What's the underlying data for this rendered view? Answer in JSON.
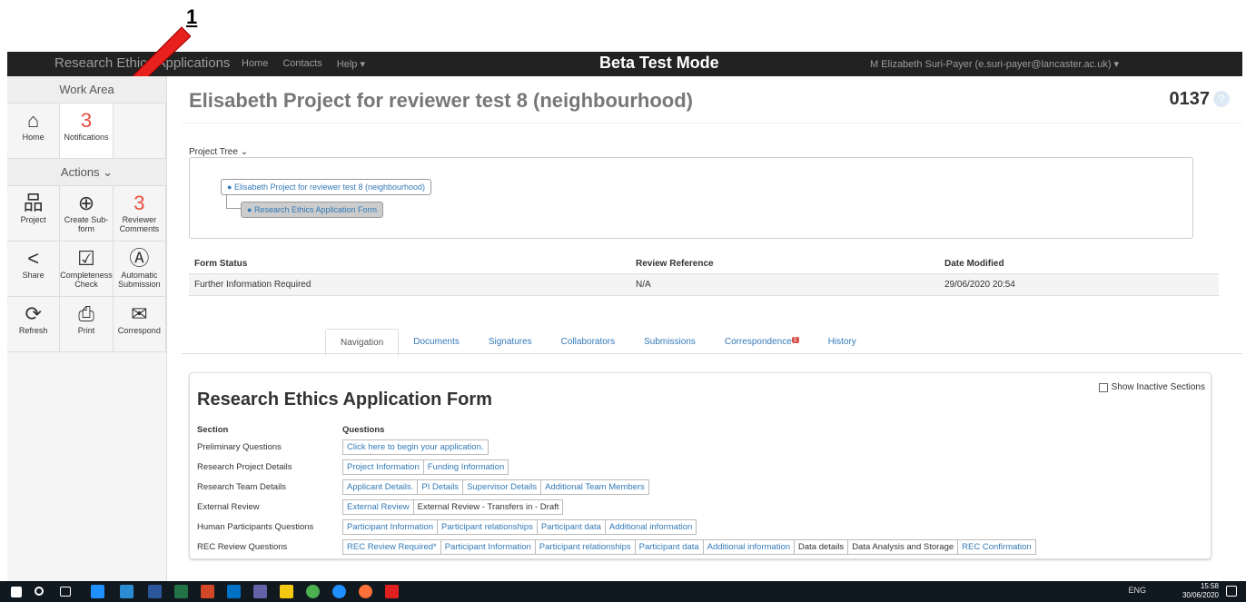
{
  "callout": "1",
  "topbar": {
    "brand": "Research Ethics Applications",
    "nav": [
      "Home",
      "Contacts",
      "Help ▾"
    ],
    "mode": "Beta Test Mode",
    "user": "M Elizabeth Suri-Payer (e.suri-payer@lancaster.ac.uk) ▾"
  },
  "sidebar": {
    "work_area": "Work Area",
    "home": "Home",
    "notifications": "Notifications",
    "notifications_count": "3",
    "actions": "Actions ⌄",
    "project": "Project",
    "create_subform": "Create Sub-form",
    "reviewer_comments": "Reviewer Comments",
    "reviewer_count": "3",
    "share": "Share",
    "completeness": "Completeness Check",
    "auto_submission": "Automatic Submission",
    "refresh": "Refresh",
    "print": "Print",
    "correspond": "Correspond"
  },
  "page": {
    "title": "Elisabeth Project for reviewer test 8 (neighbourhood)",
    "number": "0137",
    "help": "?"
  },
  "tree": {
    "label": "Project Tree ⌄",
    "root": "Elisabeth Project for reviewer test 8 (neighbourhood)",
    "child": "Research Ethics Application Form"
  },
  "status": {
    "h1": "Form Status",
    "h2": "Review Reference",
    "h3": "Date Modified",
    "v1": "Further Information Required",
    "v2": "N/A",
    "v3": "29/06/2020 20:54"
  },
  "tabs": [
    "Navigation",
    "Documents",
    "Signatures",
    "Collaborators",
    "Submissions",
    "Correspondence",
    "History"
  ],
  "tab_badge": "1",
  "form": {
    "title": "Research Ethics Application Form",
    "show_inactive": "Show Inactive Sections",
    "col_section": "Section",
    "col_questions": "Questions",
    "rows": [
      {
        "section": "Preliminary Questions",
        "q": [
          {
            "t": "Click here to begin your application.",
            "link": true
          }
        ]
      },
      {
        "section": "Research Project Details",
        "q": [
          {
            "t": "Project Information",
            "link": true
          },
          {
            "t": "Funding Information",
            "link": true
          }
        ]
      },
      {
        "section": "Research Team Details",
        "q": [
          {
            "t": "Applicant Details.",
            "link": true
          },
          {
            "t": "PI Details",
            "link": true
          },
          {
            "t": "Supervisor Details",
            "link": true
          },
          {
            "t": "Additional Team Members",
            "link": true
          }
        ]
      },
      {
        "section": "External Review",
        "q": [
          {
            "t": "External Review",
            "link": true
          },
          {
            "t": "External Review - Transfers in - Draft",
            "link": false
          }
        ]
      },
      {
        "section": "Human Participants Questions",
        "q": [
          {
            "t": "Participant Information",
            "link": true
          },
          {
            "t": "Participant relationships",
            "link": true
          },
          {
            "t": "Participant data",
            "link": true
          },
          {
            "t": "Additional information",
            "link": true
          }
        ]
      },
      {
        "section": "REC Review Questions",
        "q": [
          {
            "t": "REC Review Required*",
            "link": true
          },
          {
            "t": "Participant Information",
            "link": true
          },
          {
            "t": "Participant relationships",
            "link": true
          },
          {
            "t": "Participant data",
            "link": true
          },
          {
            "t": "Additional information",
            "link": true
          },
          {
            "t": "Data details",
            "link": false
          },
          {
            "t": "Data Analysis and Storage",
            "link": false
          },
          {
            "t": "REC Confirmation",
            "link": true
          }
        ]
      }
    ]
  },
  "taskbar": {
    "lang": "ENG",
    "time": "15:58",
    "date": "30/06/2020"
  }
}
